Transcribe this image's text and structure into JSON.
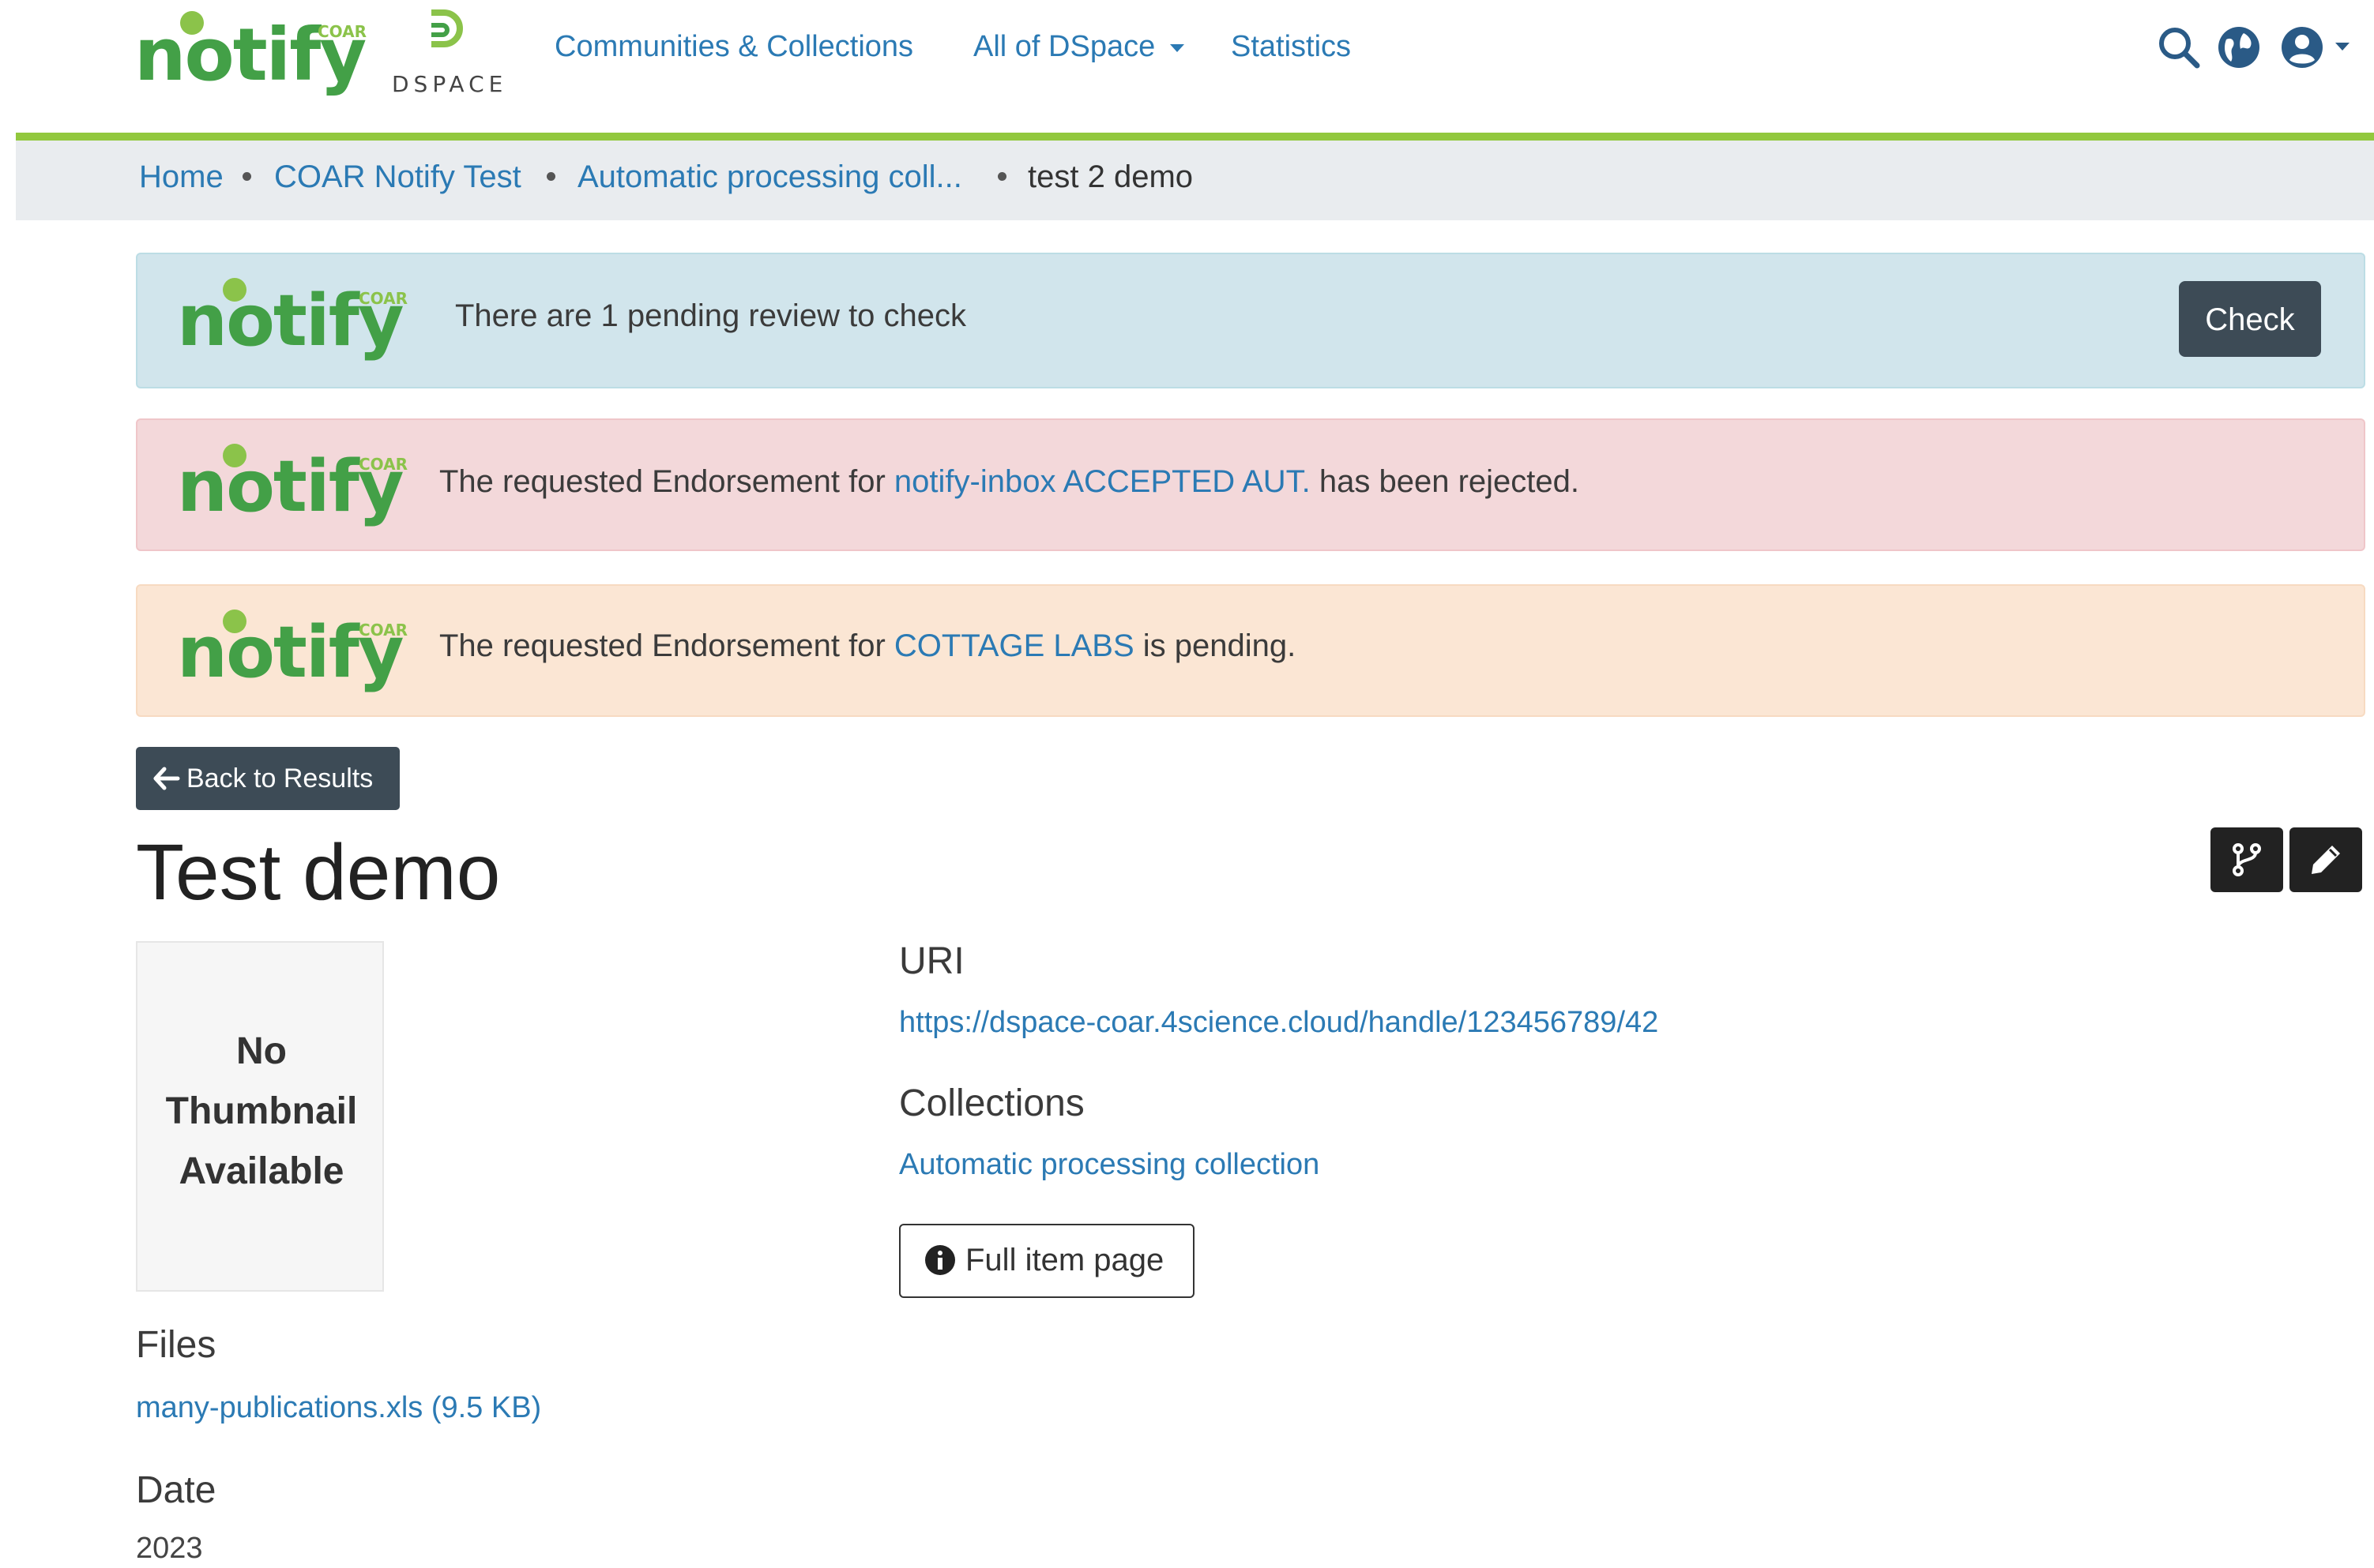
{
  "header": {
    "logo_word": "notify",
    "logo_tag": "COAR",
    "dspace_text": "DSPACE",
    "nav": {
      "communities": "Communities & Collections",
      "all_dspace": "All of DSpace",
      "statistics": "Statistics"
    },
    "icons": [
      "search-icon",
      "globe-icon",
      "user-icon",
      "caret-down-icon"
    ]
  },
  "breadcrumb": {
    "home": "Home",
    "community": "COAR Notify Test",
    "collection": "Automatic processing coll...",
    "current": "test 2 demo"
  },
  "alerts": {
    "info": {
      "text": "There are 1 pending review to check",
      "button": "Check"
    },
    "rejected": {
      "prefix": "The requested Endorsement for ",
      "link": "notify-inbox ACCEPTED AUT.",
      "suffix": " has been rejected."
    },
    "pending": {
      "prefix": "The requested Endorsement for ",
      "link": "COTTAGE LABS",
      "suffix": " is pending."
    }
  },
  "item": {
    "back_label": "Back to Results",
    "title": "Test demo",
    "thumbnail": {
      "line1": "No",
      "line2": "Thumbnail",
      "line3": "Available"
    },
    "files_label": "Files",
    "file": "many-publications.xls (9.5 KB)",
    "date_label": "Date",
    "date": "2023",
    "uri_label": "URI",
    "uri": "https://dspace-coar.4science.cloud/handle/123456789/42",
    "collections_label": "Collections",
    "collection": "Automatic processing collection",
    "full_item_label": "Full item page"
  },
  "colors": {
    "brand_green": "#43a047",
    "accent_bar": "#92c83e",
    "link": "#2b7ab4",
    "dark_button": "#3d4b56"
  }
}
